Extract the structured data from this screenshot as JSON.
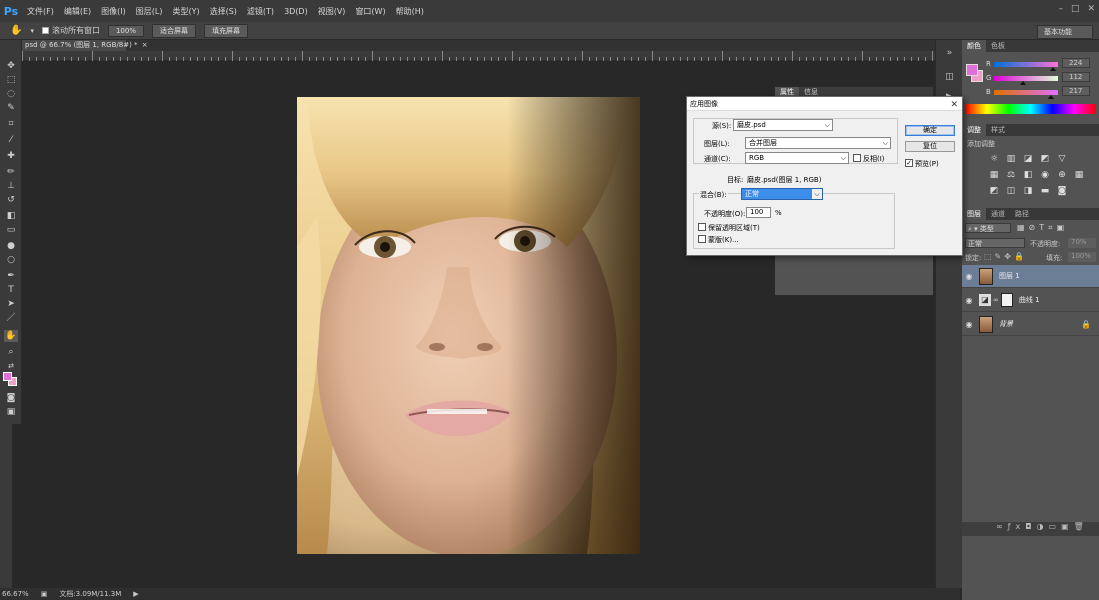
{
  "app": {
    "logo": "Ps"
  },
  "menu": [
    "文件(F)",
    "编辑(E)",
    "图像(I)",
    "图层(L)",
    "类型(Y)",
    "选择(S)",
    "滤镜(T)",
    "3D(D)",
    "视图(V)",
    "窗口(W)",
    "帮助(H)"
  ],
  "window_controls": {
    "minimize": "–",
    "maximize": "□",
    "close": "✕"
  },
  "options": {
    "scroll_all_label": "滚动所有窗口",
    "zoom_100": "100%",
    "fit_screen": "适合屏幕",
    "fill_screen": "填充屏幕",
    "workspace": "基本功能"
  },
  "document": {
    "tab_title": "psd @ 66.7% (图层 1, RGB/8#) *",
    "tab_close": "×"
  },
  "status": {
    "zoom": "66.67%",
    "doc_info": "文档:3.09M/11.3M"
  },
  "properties_panel": {
    "tabs": [
      "属性",
      "信息"
    ]
  },
  "color_panel": {
    "tabs": [
      "颜色",
      "色板"
    ],
    "channels": [
      {
        "label": "R",
        "value": "224"
      },
      {
        "label": "G",
        "value": "112"
      },
      {
        "label": "B",
        "value": "217"
      }
    ],
    "foreground_color": "#e070d9"
  },
  "adjustments_panel": {
    "tabs": [
      "调整",
      "样式"
    ],
    "add_label": "添加调整"
  },
  "layers_panel": {
    "tabs": [
      "图层",
      "通道",
      "路径"
    ],
    "kind_filter": "类型",
    "blend_mode": "正常",
    "opacity_label": "不透明度:",
    "opacity_value": "70%",
    "lock_label": "锁定:",
    "fill_label": "填充:",
    "fill_value": "100%",
    "layers": [
      {
        "name": "图层 1",
        "selected": true
      },
      {
        "name": "曲线 1",
        "selected": false
      },
      {
        "name": "背景",
        "selected": false
      }
    ]
  },
  "dialog": {
    "title": "应用图像",
    "source_label": "源(S):",
    "source_value": "磨皮.psd",
    "layer_label": "图层(L):",
    "layer_value": "合并图层",
    "channel_label": "通道(C):",
    "channel_value": "RGB",
    "invert_label": "反相(I)",
    "target_label": "目标:",
    "target_value": "磨皮.psd(图层 1, RGB)",
    "blend_label": "混合(B):",
    "blend_value": "正常",
    "opacity_label": "不透明度(O):",
    "opacity_value": "100",
    "percent": "%",
    "preserve_label": "保留透明区域(T)",
    "mask_label": "蒙版(K)...",
    "ok_label": "确定",
    "reset_label": "复位",
    "preview_label": "预览(P)",
    "preview_checked": true
  }
}
